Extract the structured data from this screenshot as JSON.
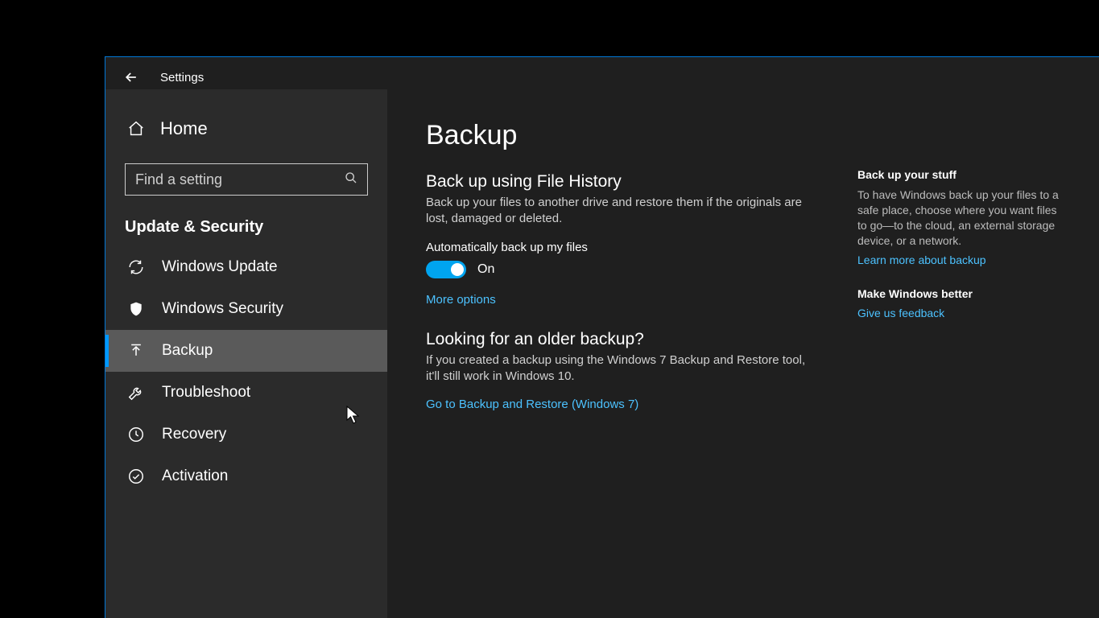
{
  "header": {
    "app_title": "Settings"
  },
  "sidebar": {
    "home_label": "Home",
    "search_placeholder": "Find a setting",
    "section_title": "Update & Security",
    "items": [
      {
        "label": "Windows Update",
        "icon": "sync"
      },
      {
        "label": "Windows Security",
        "icon": "shield"
      },
      {
        "label": "Backup",
        "icon": "backup"
      },
      {
        "label": "Troubleshoot",
        "icon": "wrench"
      },
      {
        "label": "Recovery",
        "icon": "history"
      },
      {
        "label": "Activation",
        "icon": "check-circle"
      }
    ],
    "selected_index": 2
  },
  "main": {
    "page_title": "Backup",
    "section1": {
      "title": "Back up using File History",
      "desc": "Back up your files to another drive and restore them if the originals are lost, damaged or deleted.",
      "toggle_label": "Automatically back up my files",
      "toggle_state": "On",
      "more_options": "More options"
    },
    "section2": {
      "title": "Looking for an older backup?",
      "desc": "If you created a backup using the Windows 7 Backup and Restore tool, it'll still work in Windows 10.",
      "link": "Go to Backup and Restore (Windows 7)"
    }
  },
  "right": {
    "group1": {
      "title": "Back up your stuff",
      "desc": "To have Windows back up your files to a safe place, choose where you want files to go—to the cloud, an external storage device, or a network.",
      "link": "Learn more about backup"
    },
    "group2": {
      "title": "Make Windows better",
      "link": "Give us feedback"
    }
  }
}
